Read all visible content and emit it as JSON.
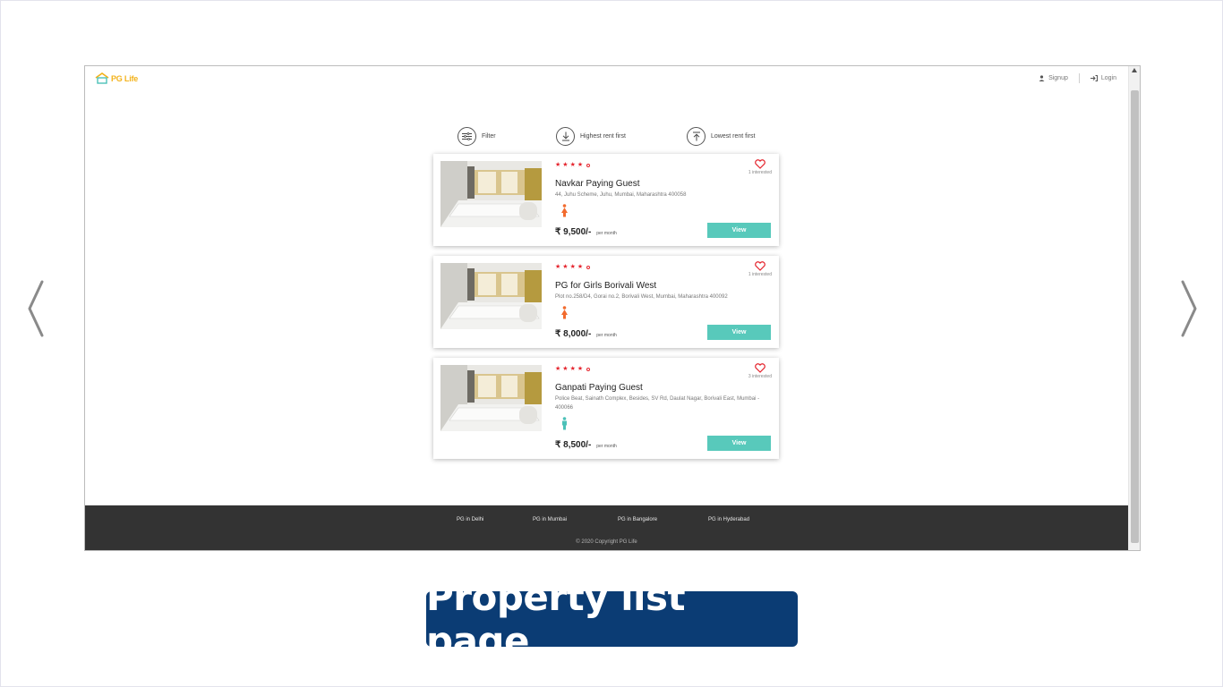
{
  "app": {
    "logo_text": "PG Life",
    "brand_color": "#f3b21a"
  },
  "header": {
    "signup_label": "Signup",
    "login_label": "Login"
  },
  "sort_bar": {
    "filter_label": "Filter",
    "highest_label": "Highest rent first",
    "lowest_label": "Lowest rent first"
  },
  "properties": [
    {
      "name": "Navkar Paying Guest",
      "address": "44, Juhu Scheme, Juhu, Mumbai, Maharashtra 400058",
      "rating": "4.5",
      "rating_color": "#e5262f",
      "interested": "1 interested",
      "gender_icon": "female-icon",
      "gender_color": "#f26b2e",
      "rent": "₹ 9,500/-",
      "rent_unit": "per month",
      "view_label": "View"
    },
    {
      "name": "PG for Girls Borivali West",
      "address": "Plot no.258/D4, Gorai no.2, Borivali West, Mumbai, Maharashtra 400092",
      "rating": "4.6",
      "rating_color": "#e5262f",
      "interested": "1 interested",
      "gender_icon": "female-icon",
      "gender_color": "#f26b2e",
      "rent": "₹ 8,000/-",
      "rent_unit": "per month",
      "view_label": "View"
    },
    {
      "name": "Ganpati Paying Guest",
      "address": "Police Beat, Sainath Complex, Besides, SV Rd, Daulat Nagar, Borivali East, Mumbai - 400066",
      "rating": "4.2",
      "rating_color": "#e5262f",
      "interested": "3 interested",
      "gender_icon": "unisex-icon",
      "gender_color": "#4cc1b8",
      "rent": "₹ 8,500/-",
      "rent_unit": "per month",
      "view_label": "View"
    }
  ],
  "footer": {
    "links": [
      "PG in Delhi",
      "PG in Mumbai",
      "PG in Bangalore",
      "PG in Hyderabad"
    ],
    "copyright": "© 2020 Copyright PG Life"
  },
  "caption": {
    "text": "Property list page",
    "background": "#0b3c74"
  },
  "accent_color": "#58c9bb"
}
